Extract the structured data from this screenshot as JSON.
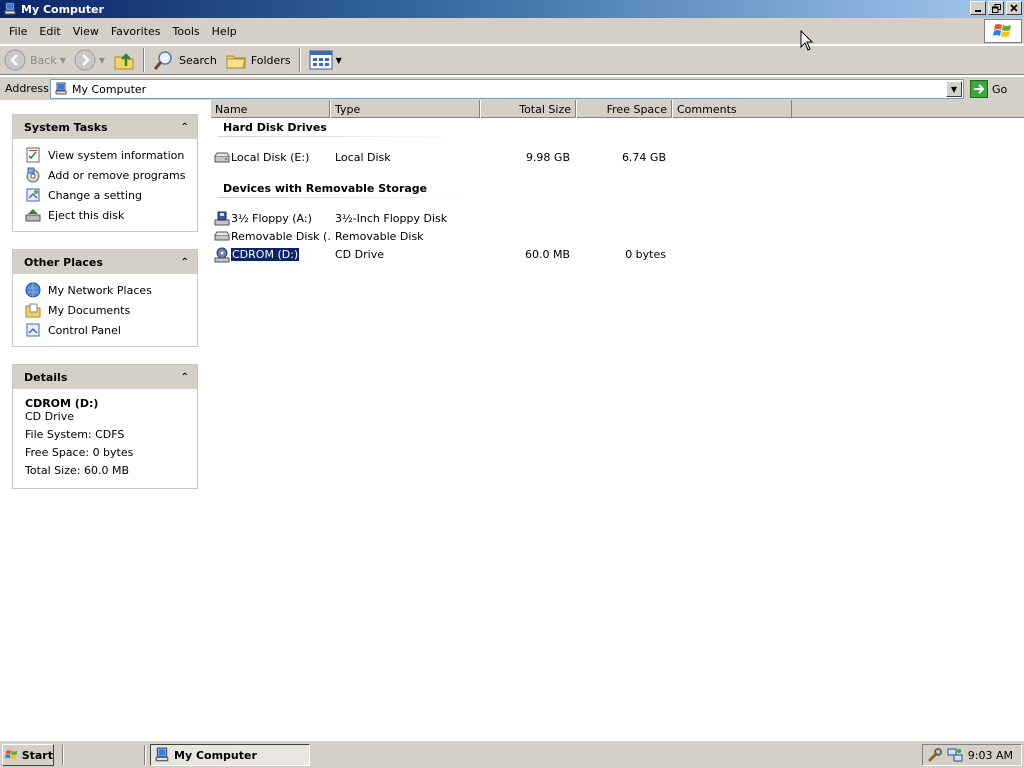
{
  "window": {
    "title": "My Computer",
    "title_icon": "my-computer-icon"
  },
  "menu": {
    "items": [
      "File",
      "Edit",
      "View",
      "Favorites",
      "Tools",
      "Help"
    ]
  },
  "toolbar": {
    "back_label": "Back",
    "search_label": "Search",
    "folders_label": "Folders"
  },
  "address": {
    "label": "Address",
    "value": "My Computer",
    "go_label": "Go"
  },
  "system_tasks": {
    "title": "System Tasks",
    "items": [
      {
        "label": "View system information",
        "icon": "system-info-icon"
      },
      {
        "label": "Add or remove programs",
        "icon": "add-remove-programs-icon"
      },
      {
        "label": "Change a setting",
        "icon": "control-setting-icon"
      },
      {
        "label": "Eject this disk",
        "icon": "eject-disk-icon"
      }
    ]
  },
  "other_places": {
    "title": "Other Places",
    "items": [
      {
        "label": "My Network Places",
        "icon": "network-places-icon"
      },
      {
        "label": "My Documents",
        "icon": "my-documents-icon"
      },
      {
        "label": "Control Panel",
        "icon": "control-panel-icon"
      }
    ]
  },
  "details": {
    "title": "Details",
    "name": "CDROM (D:)",
    "type": "CD Drive",
    "file_system": "File System: CDFS",
    "free_space": "Free Space: 0 bytes",
    "total_size": "Total Size: 60.0 MB"
  },
  "columns": [
    "Name",
    "Type",
    "Total Size",
    "Free Space",
    "Comments"
  ],
  "groups": [
    {
      "title": "Hard Disk Drives",
      "rows": [
        {
          "name": "Local Disk (E:)",
          "type": "Local Disk",
          "total": "9.98 GB",
          "free": "6.74 GB",
          "icon": "hard-disk-icon"
        }
      ]
    },
    {
      "title": "Devices with Removable Storage",
      "rows": [
        {
          "name": "3½ Floppy (A:)",
          "type": "3½-Inch Floppy Disk",
          "total": "",
          "free": "",
          "icon": "floppy-drive-icon"
        },
        {
          "name": "Removable Disk (...",
          "type": "Removable Disk",
          "total": "",
          "free": "",
          "icon": "removable-disk-icon"
        },
        {
          "name": "CDROM (D:)",
          "type": "CD Drive",
          "total": "60.0 MB",
          "free": "0 bytes",
          "icon": "cd-drive-icon",
          "selected": true
        }
      ]
    }
  ],
  "taskbar": {
    "start_label": "Start",
    "task_label": "My Computer",
    "clock": "9:03 AM"
  },
  "colors": {
    "title_gradient_start": "#0a246a",
    "title_gradient_end": "#a6caf0",
    "chrome": "#d4d0c8",
    "selection": "#0a246a"
  }
}
